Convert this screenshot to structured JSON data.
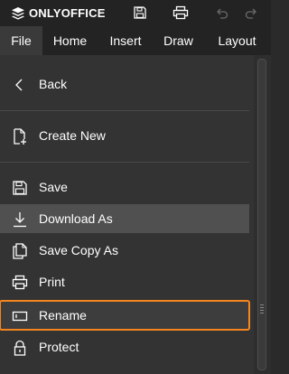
{
  "app": {
    "logo_text": "ONLYOFFICE"
  },
  "toolbar": {
    "save_icon": "save-icon",
    "print_icon": "print-icon",
    "undo_icon": "undo-icon",
    "redo_icon": "redo-icon"
  },
  "tabs": [
    {
      "label": "File",
      "active": true
    },
    {
      "label": "Home"
    },
    {
      "label": "Insert"
    },
    {
      "label": "Draw"
    },
    {
      "label": "Layout"
    }
  ],
  "menu": {
    "back": "Back",
    "create_new": "Create New",
    "save": "Save",
    "download_as": "Download As",
    "save_copy_as": "Save Copy As",
    "print": "Print",
    "rename": "Rename",
    "protect": "Protect"
  },
  "colors": {
    "accent": "#f5861f",
    "background": "#333333",
    "titlebar": "#232323",
    "hover": "#505050"
  }
}
